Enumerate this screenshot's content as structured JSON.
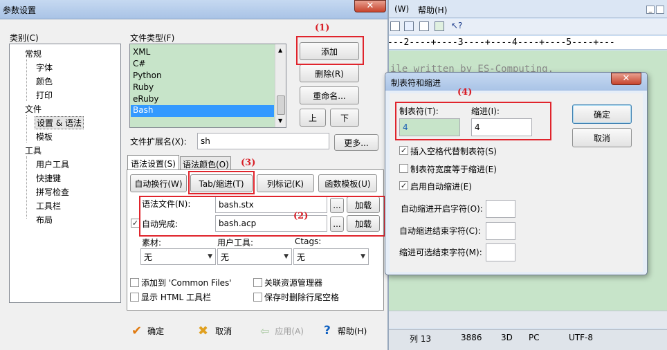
{
  "background_app": {
    "menu_items": [
      "(W)",
      "帮助(H)"
    ],
    "ruler": "---2----+----3----+----4----+----5----+---",
    "code_line1": "ile written by ES-Computing.",
    "status": {
      "col": "列 13",
      "pos": "3886",
      "mode": "3D",
      "platform": "PC",
      "encoding": "UTF-8"
    }
  },
  "main_dialog": {
    "title": "参数设置",
    "category_label": "类别(C)",
    "tree": {
      "general": "常规",
      "font": "字体",
      "color": "颜色",
      "print": "打印",
      "file": "文件",
      "settings_syntax": "设置 & 语法",
      "template": "模板",
      "tools": "工具",
      "user_tools": "用户工具",
      "shortcuts": "快捷键",
      "spell_check": "拼写检查",
      "toolbar": "工具栏",
      "layout": "布局"
    },
    "file_types_label": "文件类型(F)",
    "file_types": [
      "XML",
      "C#",
      "Python",
      "Ruby",
      "eRuby",
      "Bash"
    ],
    "selected_file_type": "Bash",
    "add_button": "添加",
    "delete_button": "删除(R)",
    "rename_button": "重命名...",
    "up_button": "上",
    "down_button": "下",
    "ext_label": "文件扩展名(X):",
    "ext_value": "sh",
    "more_button": "更多...",
    "tabs": {
      "syntax_settings": "语法设置(S)",
      "syntax_color": "语法颜色(O)"
    },
    "auto_wrap_button": "自动换行(W)",
    "tab_indent_button": "Tab/缩进(T)",
    "col_marker_button": "列标记(K)",
    "func_template_button": "函数模板(U)",
    "syntax_file_label": "语法文件(N):",
    "syntax_file_value": "bash.stx",
    "autocomplete_label": "自动完成:",
    "autocomplete_value": "bash.acp",
    "browse_label": "...",
    "load_label": "加载",
    "material_label": "素材:",
    "user_tools_label": "用户工具:",
    "ctags_label": "Ctags:",
    "none_option": "无",
    "add_common_files": "添加到 'Common Files'",
    "assoc_explorer": "关联资源管理器",
    "show_html_toolbar": "显示 HTML 工具栏",
    "trim_trailing": "保存时删除行尾空格",
    "ok": "确定",
    "cancel": "取消",
    "apply": "应用(A)",
    "help": "帮助(H)"
  },
  "tab_dialog": {
    "title": "制表符和缩进",
    "tab_label": "制表符(T):",
    "tab_value": "4",
    "indent_label": "缩进(I):",
    "indent_value": "4",
    "ok": "确定",
    "cancel": "取消",
    "insert_spaces": "插入空格代替制表符(S)",
    "tab_width_equal": "制表符宽度等于缩进(E)",
    "auto_indent": "启用自动缩进(E)",
    "auto_indent_open": "自动缩进开启字符(O):",
    "auto_indent_close": "自动缩进结束字符(C):",
    "indent_optional_end": "缩进可选结束字符(M):"
  },
  "annotations": [
    "(1)",
    "(2)",
    "(3)",
    "(4)"
  ]
}
